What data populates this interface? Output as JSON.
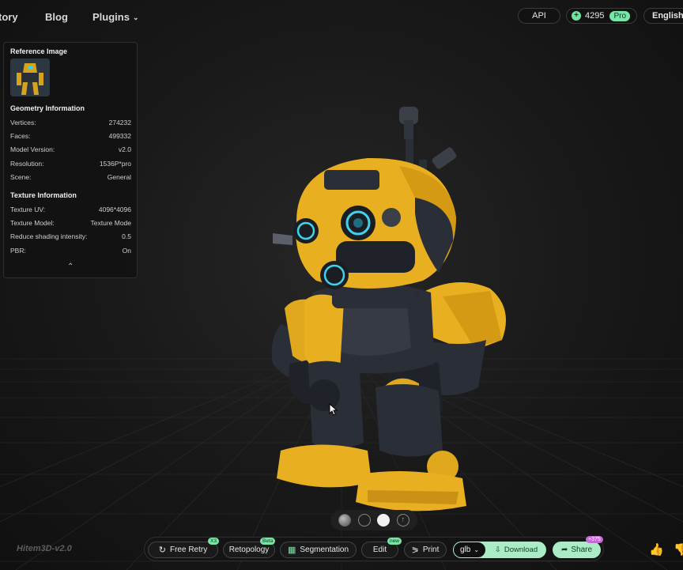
{
  "nav": {
    "history_label": "tory",
    "blog_label": "Blog",
    "plugins_label": "Plugins",
    "api_label": "API",
    "credits": "4295",
    "credits_icon": "plus-icon",
    "pro_label": "Pro",
    "language_label": "English"
  },
  "panel": {
    "reference_title": "Reference Image",
    "geometry_title": "Geometry Information",
    "geometry": [
      {
        "key": "Vertices:",
        "value": "274232"
      },
      {
        "key": "Faces:",
        "value": "499332"
      },
      {
        "key": "Model Version:",
        "value": "v2.0"
      },
      {
        "key": "Resolution:",
        "value": "1536P*pro"
      },
      {
        "key": "Scene:",
        "value": "General"
      }
    ],
    "texture_title": "Texture Information",
    "texture": [
      {
        "key": "Texture UV:",
        "value": "4096*4096"
      },
      {
        "key": "Texture Model:",
        "value": "Texture Mode"
      },
      {
        "key": "Reduce shading intensity:",
        "value": "0.5"
      },
      {
        "key": "PBR:",
        "value": "On"
      }
    ],
    "collapse_icon": "chevron-up-icon"
  },
  "watermark": "Hitem3D-v2.0",
  "toolbar": {
    "free_retry_label": "Free Retry",
    "free_retry_tag": "X3",
    "retopology_label": "Retopology",
    "retopology_tag": "Beta",
    "segmentation_label": "Segmentation",
    "edit_label": "Edit",
    "edit_tag": "new",
    "print_label": "Print",
    "format_value": "glb",
    "download_label": "Download",
    "share_label": "Share",
    "share_tag": "+375"
  },
  "colors": {
    "accent_green": "#a9ecc5",
    "robot_yellow": "#e8b020",
    "robot_dark": "#2a2e36",
    "glow_cyan": "#3fd4ee"
  }
}
